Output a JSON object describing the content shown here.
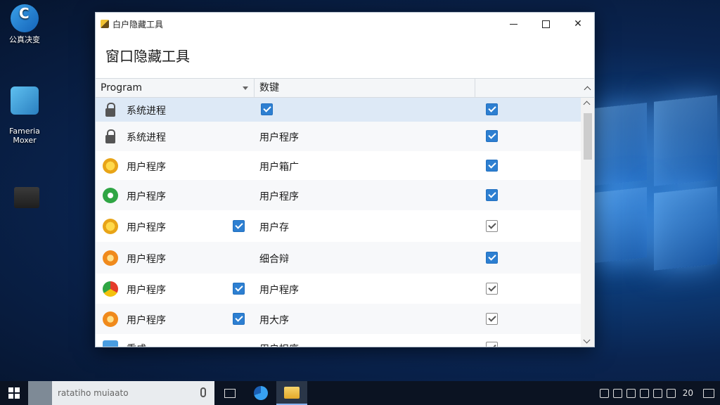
{
  "desktop": {
    "icons": [
      {
        "label": "公真决变",
        "icon": "app-c-icon"
      },
      {
        "label": "Fameria\nMoxer",
        "icon": "movie-maker-icon"
      },
      {
        "label": "",
        "icon": "folder-dark-icon"
      }
    ]
  },
  "window": {
    "title": "白户隐藏工具",
    "heading": "窗口隐藏工具",
    "columns": {
      "program": "Program",
      "type": "数键"
    },
    "rows": [
      {
        "name": "系统进程",
        "type": "",
        "icon": "lock-icon",
        "mid_check": false,
        "type_check": true,
        "visible": true,
        "visible_style": "on",
        "selected": true
      },
      {
        "name": "系统进程",
        "type": "用户程序",
        "icon": "lock-icon",
        "mid_check": false,
        "type_check": false,
        "visible": true,
        "visible_style": "on"
      },
      {
        "name": "用户程序",
        "type": "用户箱广",
        "icon": "yellow-star-icon",
        "mid_check": false,
        "type_check": false,
        "visible": true,
        "visible_style": "on"
      },
      {
        "name": "用户程序",
        "type": "用户程序",
        "icon": "green-arrow-icon",
        "mid_check": false,
        "type_check": false,
        "visible": true,
        "visible_style": "on"
      },
      {
        "name": "用户程序",
        "type": "用户存",
        "icon": "yellow-star-icon",
        "mid_check": true,
        "type_check": false,
        "visible": true,
        "visible_style": "off"
      },
      {
        "name": "用户程序",
        "type": "细合辩",
        "icon": "orange-star-icon",
        "mid_check": false,
        "type_check": false,
        "visible": true,
        "visible_style": "on"
      },
      {
        "name": "用户程序",
        "type": "用户程序",
        "icon": "multicolor-icon",
        "mid_check": true,
        "type_check": false,
        "visible": true,
        "visible_style": "off"
      },
      {
        "name": "用户程序",
        "type": "用大序",
        "icon": "orange-star-icon",
        "mid_check": true,
        "type_check": false,
        "visible": true,
        "visible_style": "off"
      },
      {
        "name": "重成",
        "type": "用户扣序",
        "icon": "blue-app-icon",
        "mid_check": false,
        "type_check": false,
        "visible": true,
        "visible_style": "off"
      }
    ]
  },
  "taskbar": {
    "search_placeholder": "ratatiho muiaato",
    "time": "20"
  }
}
